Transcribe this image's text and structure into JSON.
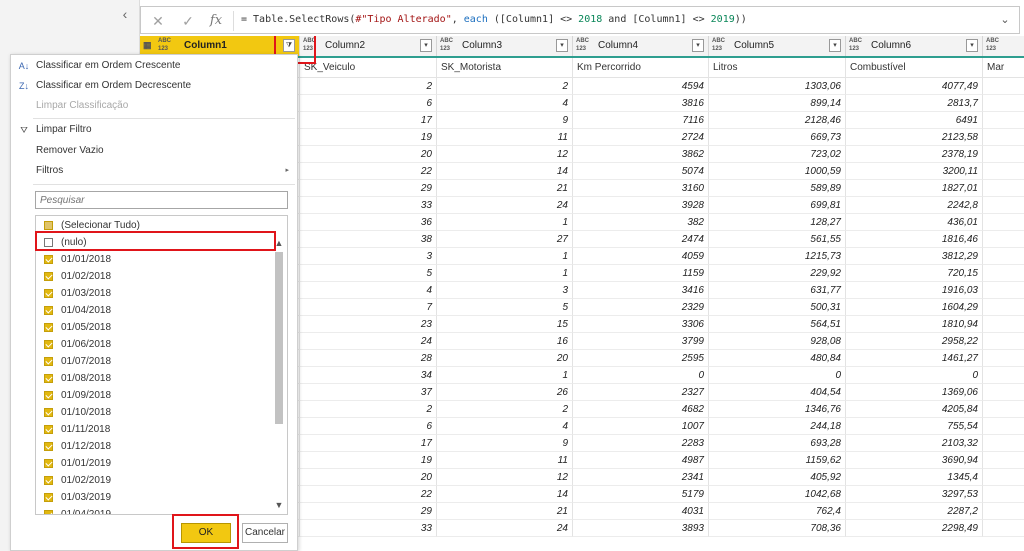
{
  "formula_bar": {
    "prefix": "= Table.SelectRows(",
    "ref": "#\"Tipo Alterado\"",
    "sep": ", ",
    "each_kw": "each",
    "cond_a": " ([Column1] <> ",
    "val_a": "2018",
    "and_kw": " and ",
    "cond_b": "[Column1] <> ",
    "val_b": "2019",
    "suffix": "))",
    "cancel_icon": "close-icon",
    "commit_icon": "check-icon",
    "fx_label": "fx",
    "expand_icon": "chevron-down-icon"
  },
  "columns": [
    {
      "name": "Column1",
      "type": "ABC\n123"
    },
    {
      "name": "Column2",
      "type": "ABC\n123"
    },
    {
      "name": "Column3",
      "type": "ABC\n123"
    },
    {
      "name": "Column4",
      "type": "ABC\n123"
    },
    {
      "name": "Column5",
      "type": "ABC\n123"
    },
    {
      "name": "Column6",
      "type": "ABC\n123"
    },
    {
      "name": "",
      "type": "ABC\n123"
    }
  ],
  "first_row": [
    "",
    "SK_Veiculo",
    "SK_Motorista",
    "Km Percorrido",
    "Litros",
    "Combustível",
    "Mar"
  ],
  "rows": [
    [
      "2",
      "2",
      "4594",
      "1303,06",
      "4077,49"
    ],
    [
      "6",
      "4",
      "3816",
      "899,14",
      "2813,7"
    ],
    [
      "17",
      "9",
      "7116",
      "2128,46",
      "6491"
    ],
    [
      "19",
      "11",
      "2724",
      "669,73",
      "2123,58"
    ],
    [
      "20",
      "12",
      "3862",
      "723,02",
      "2378,19"
    ],
    [
      "22",
      "14",
      "5074",
      "1000,59",
      "3200,11"
    ],
    [
      "29",
      "21",
      "3160",
      "589,89",
      "1827,01"
    ],
    [
      "33",
      "24",
      "3928",
      "699,81",
      "2242,8"
    ],
    [
      "36",
      "1",
      "382",
      "128,27",
      "436,01"
    ],
    [
      "38",
      "27",
      "2474",
      "561,55",
      "1816,46"
    ],
    [
      "3",
      "1",
      "4059",
      "1215,73",
      "3812,29"
    ],
    [
      "5",
      "1",
      "1159",
      "229,92",
      "720,15"
    ],
    [
      "4",
      "3",
      "3416",
      "631,77",
      "1916,03"
    ],
    [
      "7",
      "5",
      "2329",
      "500,31",
      "1604,29"
    ],
    [
      "23",
      "15",
      "3306",
      "564,51",
      "1810,94"
    ],
    [
      "24",
      "16",
      "3799",
      "928,08",
      "2958,22"
    ],
    [
      "28",
      "20",
      "2595",
      "480,84",
      "1461,27"
    ],
    [
      "34",
      "1",
      "0",
      "0",
      "0"
    ],
    [
      "37",
      "26",
      "2327",
      "404,54",
      "1369,06"
    ],
    [
      "2",
      "2",
      "4682",
      "1346,76",
      "4205,84"
    ],
    [
      "6",
      "4",
      "1007",
      "244,18",
      "755,54"
    ],
    [
      "17",
      "9",
      "2283",
      "693,28",
      "2103,32"
    ],
    [
      "19",
      "11",
      "4987",
      "1159,62",
      "3690,94"
    ],
    [
      "20",
      "12",
      "2341",
      "405,92",
      "1345,4"
    ],
    [
      "22",
      "14",
      "5179",
      "1042,68",
      "3297,53"
    ],
    [
      "29",
      "21",
      "4031",
      "762,4",
      "2287,2"
    ],
    [
      "33",
      "24",
      "3893",
      "708,36",
      "2298,49"
    ]
  ],
  "menu": {
    "sort_asc": "Classificar em Ordem Crescente",
    "sort_desc": "Classificar em Ordem Decrescente",
    "clear_sort": "Limpar Classificação",
    "clear_filter": "Limpar Filtro",
    "remove_empty": "Remover Vazio",
    "filters": "Filtros",
    "search_placeholder": "Pesquisar",
    "ok": "OK",
    "cancel": "Cancelar"
  },
  "checklist": [
    {
      "label": "(Selecionar Tudo)",
      "state": "partial"
    },
    {
      "label": "(nulo)",
      "state": "off"
    },
    {
      "label": "01/01/2018",
      "state": "on"
    },
    {
      "label": "01/02/2018",
      "state": "on"
    },
    {
      "label": "01/03/2018",
      "state": "on"
    },
    {
      "label": "01/04/2018",
      "state": "on"
    },
    {
      "label": "01/05/2018",
      "state": "on"
    },
    {
      "label": "01/06/2018",
      "state": "on"
    },
    {
      "label": "01/07/2018",
      "state": "on"
    },
    {
      "label": "01/08/2018",
      "state": "on"
    },
    {
      "label": "01/09/2018",
      "state": "on"
    },
    {
      "label": "01/10/2018",
      "state": "on"
    },
    {
      "label": "01/11/2018",
      "state": "on"
    },
    {
      "label": "01/12/2018",
      "state": "on"
    },
    {
      "label": "01/01/2019",
      "state": "on"
    },
    {
      "label": "01/02/2019",
      "state": "on"
    },
    {
      "label": "01/03/2019",
      "state": "on"
    },
    {
      "label": "01/04/2019",
      "state": "on"
    }
  ],
  "colors": {
    "accent": "#f2c811",
    "highlight": "#e0151a",
    "quality": "#2e9e8f"
  }
}
